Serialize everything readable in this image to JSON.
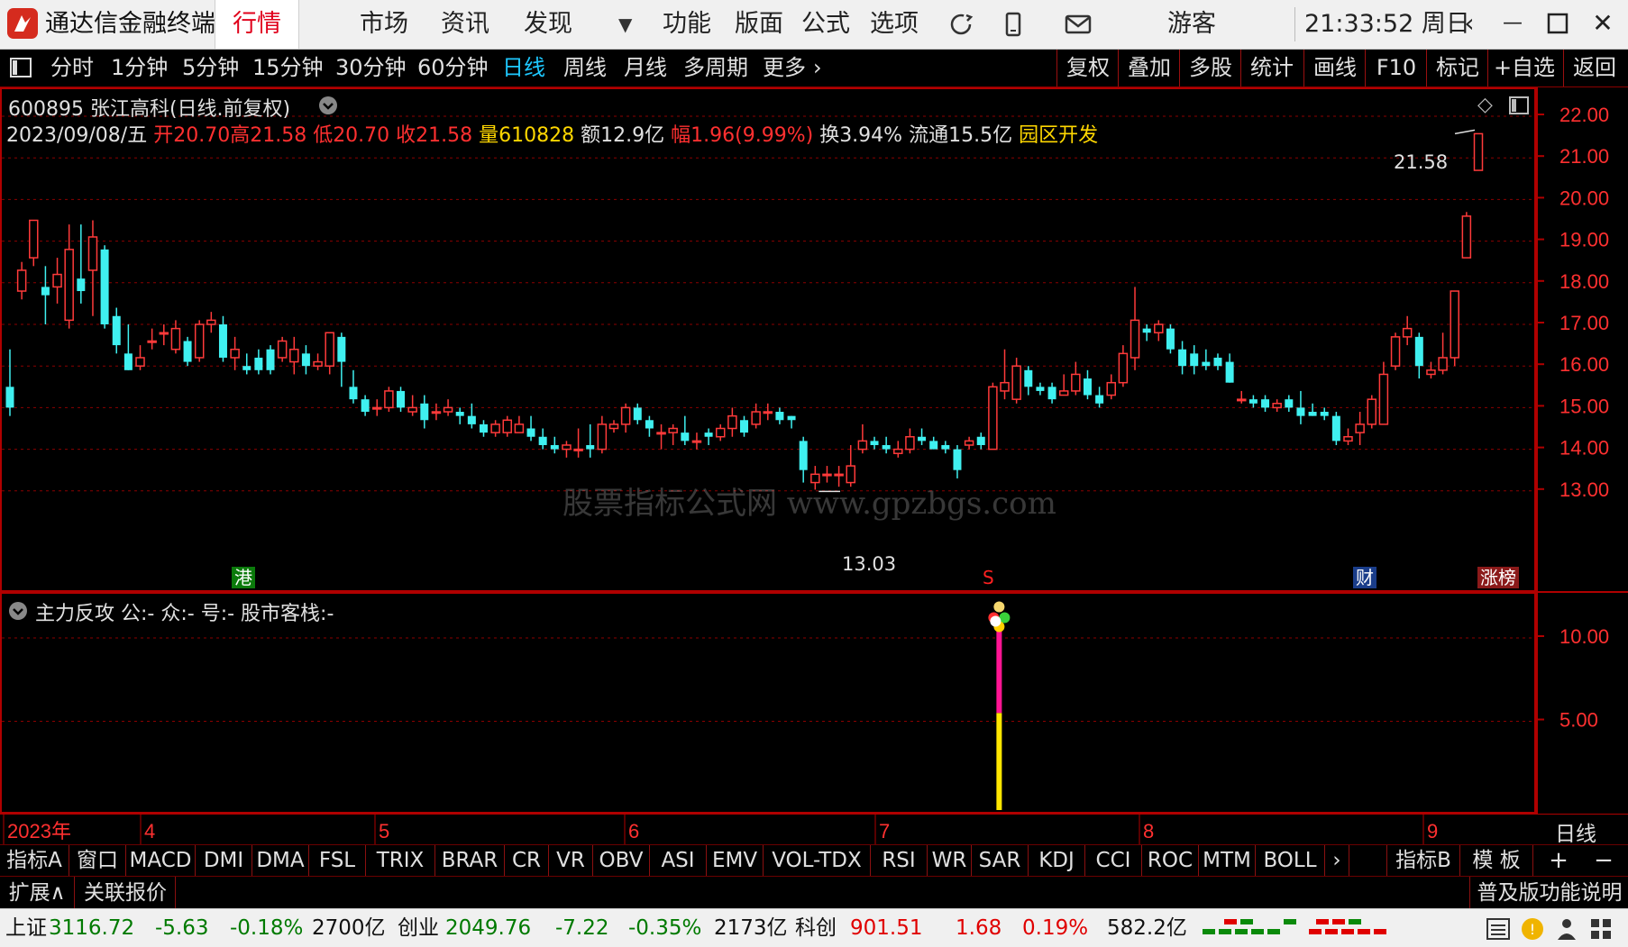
{
  "app": {
    "title": "通达信金融终端",
    "tabs": [
      "行情",
      "市场",
      "资讯",
      "发现",
      "功能",
      "版面",
      "公式",
      "选项"
    ],
    "user": "游客",
    "clock": "21:33:52 周日"
  },
  "periods": [
    "分时",
    "1分钟",
    "5分钟",
    "15分钟",
    "30分钟",
    "60分钟",
    "日线",
    "周线",
    "月线",
    "多周期",
    "更多"
  ],
  "active_period": "日线",
  "tools": [
    "复权",
    "叠加",
    "多股",
    "统计",
    "画线",
    "F10",
    "标记",
    "+自选",
    "返回"
  ],
  "stock": {
    "header": "600895 张江高科(日线.前复权)",
    "date": "2023/09/08/五",
    "open": "开20.70",
    "high": "高21.58",
    "low": "低20.70",
    "close": "收21.58",
    "volume": "量610828",
    "amount": "额12.9亿",
    "change": "幅1.96(9.99%)",
    "turnover": "换3.94%",
    "float": "流通15.5亿",
    "sector": "园区开发",
    "max_label": "21.58",
    "min_label": "13.03",
    "markers": [
      "港",
      "S",
      "财",
      "涨榜"
    ]
  },
  "indicator": {
    "title": "主力反攻",
    "params": "公:-  众:-  号:-  股市客栈:-"
  },
  "watermark": "股票指标公式网 www.gpzbgs.com",
  "axis": {
    "main_ticks": [
      "22.00",
      "21.00",
      "20.00",
      "19.00",
      "18.00",
      "17.00",
      "16.00",
      "15.00",
      "14.00",
      "13.00"
    ],
    "sub_ticks": [
      "10.00",
      "5.00"
    ],
    "time_labels": [
      "2023年",
      "4",
      "5",
      "6",
      "7",
      "8",
      "9"
    ],
    "period_label": "日线"
  },
  "indicators": [
    "指标A",
    "窗口",
    "MACD",
    "DMI",
    "DMA",
    "FSL",
    "TRIX",
    "BRAR",
    "CR",
    "VR",
    "OBV",
    "ASI",
    "EMV",
    "VOL-TDX",
    "RSI",
    "WR",
    "SAR",
    "KDJ",
    "CCI",
    "ROC",
    "MTM",
    "BOLL"
  ],
  "indicator_right": [
    "指标B",
    "模 板"
  ],
  "extbar": {
    "expand": "扩展∧",
    "related": "关联报价",
    "help": "普及版功能说明"
  },
  "status": {
    "sh_name": "上证",
    "sh_val": "3116.72",
    "sh_chg": "-5.63",
    "sh_pct": "-0.18%",
    "sh_amt": "2700亿",
    "cy_name": "创业",
    "cy_val": "2049.76",
    "cy_chg": "-7.22",
    "cy_pct": "-0.35%",
    "cy_amt": "2173亿",
    "kc_name": "科创",
    "kc_val": "901.51",
    "kc_chg": "1.68",
    "kc_pct": "0.19%",
    "kc_amt": "582.2亿"
  },
  "chart_data": {
    "type": "candlestick",
    "y_range": [
      12.6,
      22.4
    ],
    "candles": [
      [
        15.5,
        15.0,
        16.4,
        14.8
      ],
      [
        17.8,
        18.3,
        18.5,
        17.6
      ],
      [
        18.6,
        19.5,
        19.5,
        18.4
      ],
      [
        17.9,
        17.7,
        18.4,
        17.0
      ],
      [
        17.9,
        18.2,
        18.6,
        17.5
      ],
      [
        17.1,
        18.8,
        19.4,
        16.9
      ],
      [
        18.1,
        17.8,
        19.4,
        17.5
      ],
      [
        18.3,
        19.1,
        19.5,
        17.2
      ],
      [
        18.8,
        17.0,
        18.9,
        16.9
      ],
      [
        17.2,
        16.5,
        17.4,
        16.3
      ],
      [
        16.3,
        15.9,
        17.0,
        15.9
      ],
      [
        16.0,
        16.2,
        16.5,
        15.9
      ],
      [
        16.6,
        16.6,
        16.9,
        16.4
      ],
      [
        16.8,
        16.8,
        17.0,
        16.5
      ],
      [
        16.4,
        16.9,
        17.1,
        16.3
      ],
      [
        16.6,
        16.1,
        16.7,
        16.0
      ],
      [
        16.2,
        17.0,
        17.1,
        16.1
      ],
      [
        17.0,
        17.1,
        17.3,
        16.8
      ],
      [
        17.0,
        16.2,
        17.2,
        16.1
      ],
      [
        16.2,
        16.4,
        16.7,
        15.9
      ],
      [
        16.0,
        15.9,
        16.3,
        15.8
      ],
      [
        16.2,
        15.9,
        16.4,
        15.8
      ],
      [
        16.4,
        15.9,
        16.5,
        15.8
      ],
      [
        16.2,
        16.6,
        16.7,
        16.1
      ],
      [
        16.1,
        16.4,
        16.7,
        15.8
      ],
      [
        16.3,
        16.0,
        16.5,
        15.8
      ],
      [
        16.0,
        16.1,
        16.3,
        15.9
      ],
      [
        16.0,
        16.8,
        16.8,
        15.8
      ],
      [
        16.7,
        16.1,
        16.8,
        15.5
      ],
      [
        15.5,
        15.2,
        15.9,
        15.1
      ],
      [
        15.2,
        14.9,
        15.3,
        14.8
      ],
      [
        15.0,
        15.0,
        15.2,
        14.8
      ],
      [
        15.0,
        15.4,
        15.5,
        14.9
      ],
      [
        15.4,
        15.0,
        15.5,
        14.9
      ],
      [
        14.9,
        15.0,
        15.3,
        14.8
      ],
      [
        15.1,
        14.7,
        15.3,
        14.5
      ],
      [
        14.9,
        14.9,
        15.1,
        14.7
      ],
      [
        14.9,
        15.0,
        15.2,
        14.8
      ],
      [
        14.9,
        14.8,
        15.0,
        14.6
      ],
      [
        14.8,
        14.6,
        15.1,
        14.5
      ],
      [
        14.6,
        14.4,
        14.7,
        14.3
      ],
      [
        14.4,
        14.6,
        14.7,
        14.3
      ],
      [
        14.4,
        14.7,
        14.8,
        14.3
      ],
      [
        14.4,
        14.6,
        14.8,
        14.4
      ],
      [
        14.5,
        14.3,
        14.8,
        14.2
      ],
      [
        14.3,
        14.1,
        14.5,
        14.0
      ],
      [
        14.1,
        14.0,
        14.3,
        13.9
      ],
      [
        14.0,
        14.1,
        14.2,
        13.8
      ],
      [
        14.0,
        14.0,
        14.5,
        13.8
      ],
      [
        14.1,
        14.0,
        14.6,
        13.8
      ],
      [
        14.0,
        14.6,
        14.8,
        13.9
      ],
      [
        14.5,
        14.6,
        14.7,
        14.4
      ],
      [
        14.6,
        15.0,
        15.1,
        14.4
      ],
      [
        15.0,
        14.7,
        15.1,
        14.6
      ],
      [
        14.7,
        14.5,
        14.8,
        14.3
      ],
      [
        14.4,
        14.4,
        14.6,
        14.0
      ],
      [
        14.4,
        14.5,
        14.6,
        14.1
      ],
      [
        14.4,
        14.2,
        14.8,
        14.1
      ],
      [
        14.2,
        14.2,
        14.4,
        14.0
      ],
      [
        14.4,
        14.3,
        14.5,
        14.1
      ],
      [
        14.3,
        14.5,
        14.6,
        14.2
      ],
      [
        14.5,
        14.8,
        15.0,
        14.3
      ],
      [
        14.7,
        14.4,
        14.8,
        14.3
      ],
      [
        14.6,
        14.9,
        15.1,
        14.5
      ],
      [
        14.9,
        14.9,
        15.1,
        14.7
      ],
      [
        14.9,
        14.7,
        15.0,
        14.6
      ],
      [
        14.8,
        14.7,
        14.8,
        14.5
      ],
      [
        14.2,
        13.5,
        14.3,
        13.2
      ],
      [
        13.2,
        13.4,
        13.6,
        13.03
      ],
      [
        13.4,
        13.4,
        13.6,
        13.2
      ],
      [
        13.4,
        13.4,
        13.6,
        13.1
      ],
      [
        13.2,
        13.6,
        14.1,
        13.1
      ],
      [
        14.0,
        14.2,
        14.6,
        13.9
      ],
      [
        14.2,
        14.1,
        14.3,
        14.0
      ],
      [
        14.1,
        14.0,
        14.3,
        13.9
      ],
      [
        13.9,
        14.0,
        14.2,
        13.8
      ],
      [
        14.0,
        14.3,
        14.5,
        13.9
      ],
      [
        14.3,
        14.2,
        14.5,
        14.1
      ],
      [
        14.2,
        14.0,
        14.3,
        14.0
      ],
      [
        14.1,
        14.0,
        14.2,
        13.9
      ],
      [
        14.0,
        13.5,
        14.1,
        13.3
      ],
      [
        14.1,
        14.2,
        14.3,
        14.0
      ],
      [
        14.3,
        14.1,
        14.4,
        14.0
      ],
      [
        14.0,
        15.5,
        15.6,
        14.0
      ],
      [
        15.4,
        15.6,
        16.4,
        15.2
      ],
      [
        15.2,
        16.0,
        16.2,
        15.1
      ],
      [
        15.9,
        15.5,
        16.0,
        15.3
      ],
      [
        15.5,
        15.4,
        15.6,
        15.3
      ],
      [
        15.5,
        15.2,
        15.6,
        15.1
      ],
      [
        15.3,
        15.4,
        15.8,
        15.3
      ],
      [
        15.4,
        15.8,
        16.1,
        15.3
      ],
      [
        15.7,
        15.3,
        15.9,
        15.2
      ],
      [
        15.3,
        15.1,
        15.5,
        15.0
      ],
      [
        15.3,
        15.6,
        15.8,
        15.2
      ],
      [
        15.6,
        16.3,
        16.5,
        15.5
      ],
      [
        16.2,
        17.1,
        17.9,
        15.9
      ],
      [
        16.9,
        16.8,
        17.0,
        16.6
      ],
      [
        16.8,
        17.0,
        17.1,
        16.6
      ],
      [
        16.9,
        16.4,
        17.0,
        16.3
      ],
      [
        16.4,
        16.0,
        16.6,
        15.8
      ],
      [
        16.3,
        16.0,
        16.5,
        15.8
      ],
      [
        16.1,
        16.0,
        16.4,
        15.9
      ],
      [
        16.2,
        16.0,
        16.3,
        15.9
      ],
      [
        16.1,
        15.6,
        16.3,
        15.6
      ],
      [
        15.2,
        15.2,
        15.4,
        15.1
      ],
      [
        15.2,
        15.1,
        15.3,
        15.0
      ],
      [
        15.2,
        15.0,
        15.3,
        14.9
      ],
      [
        15.0,
        15.1,
        15.2,
        14.9
      ],
      [
        15.2,
        15.0,
        15.3,
        14.9
      ],
      [
        15.0,
        14.8,
        15.4,
        14.6
      ],
      [
        14.9,
        14.8,
        15.1,
        14.8
      ],
      [
        14.9,
        14.8,
        15.0,
        14.7
      ],
      [
        14.8,
        14.2,
        14.9,
        14.1
      ],
      [
        14.2,
        14.3,
        14.5,
        14.1
      ],
      [
        14.4,
        14.6,
        14.9,
        14.1
      ],
      [
        14.6,
        15.2,
        15.3,
        14.5
      ],
      [
        14.6,
        15.8,
        16.1,
        14.6
      ],
      [
        16.0,
        16.7,
        16.8,
        15.9
      ],
      [
        16.7,
        16.9,
        17.2,
        16.5
      ],
      [
        16.7,
        16.0,
        16.8,
        15.7
      ],
      [
        15.8,
        15.9,
        16.1,
        15.7
      ],
      [
        15.9,
        16.2,
        16.8,
        15.8
      ],
      [
        16.2,
        17.8,
        17.8,
        16.0
      ],
      [
        18.6,
        19.6,
        19.7,
        18.6
      ],
      [
        20.7,
        21.58,
        21.58,
        20.7
      ]
    ],
    "signal_index": 83,
    "signal_value": 11
  }
}
